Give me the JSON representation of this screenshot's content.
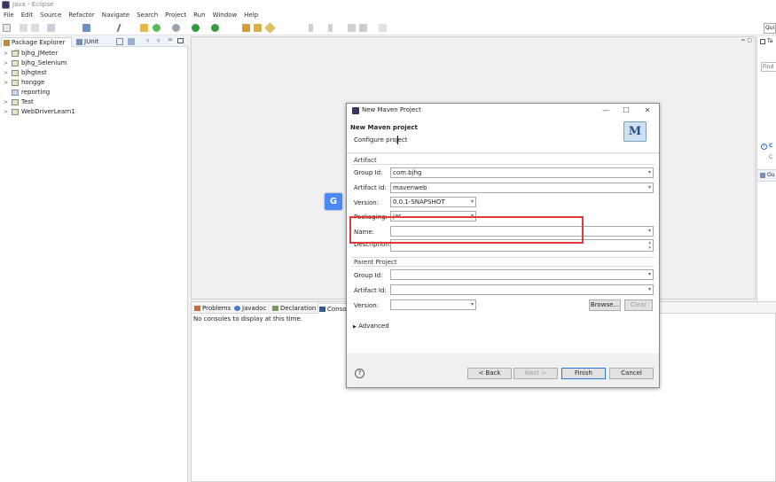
{
  "window": {
    "title": "Java - Eclipse"
  },
  "menu": [
    "File",
    "Edit",
    "Source",
    "Refactor",
    "Navigate",
    "Search",
    "Project",
    "Run",
    "Window",
    "Help"
  ],
  "quick_access": {
    "label": "Qui"
  },
  "package_explorer": {
    "tab_label": "Package Explorer",
    "tab_close": "☒",
    "junit_tab": "JUnit",
    "items": [
      {
        "label": "bjhg_JMeter",
        "type": "project"
      },
      {
        "label": "bjhg_Selenium",
        "type": "project"
      },
      {
        "label": "bjhgtest",
        "type": "project"
      },
      {
        "label": "hongge",
        "type": "project"
      },
      {
        "label": "reporting",
        "type": "folder"
      },
      {
        "label": "Test",
        "type": "project"
      },
      {
        "label": "WebDriverLearn1",
        "type": "project"
      }
    ]
  },
  "right_panel": {
    "tab_label": "Ta",
    "find_placeholder": "Find",
    "item1": "C",
    "item2": "C",
    "outline_label": "Ou"
  },
  "console": {
    "tabs": [
      "Problems",
      "Javadoc",
      "Declaration",
      "Consol"
    ],
    "message": "No consoles to display at this time."
  },
  "dialog": {
    "title": "New Maven Project",
    "header_title": "New Maven project",
    "header_subtitle": "Configure project",
    "logo_letter": "M",
    "artifact_group": "Artifact",
    "group_id_label": "Group Id:",
    "group_id_value": "com.bjhg",
    "artifact_id_label": "Artifact Id:",
    "artifact_id_value": "mavenweb",
    "version_label": "Version:",
    "version_value": "0.0.1-SNAPSHOT",
    "packaging_label": "Packaging:",
    "packaging_value": "jar",
    "name_label": "Name:",
    "name_value": "",
    "description_label": "Description:",
    "description_value": "",
    "parent_group": "Parent Project",
    "parent_group_id_label": "Group Id:",
    "parent_artifact_id_label": "Artifact Id:",
    "parent_version_label": "Version:",
    "browse_button": "Browse...",
    "clear_button": "Clear",
    "advanced_label": "Advanced",
    "back_button": "< Back",
    "next_button": "Next >",
    "finish_button": "Finish",
    "cancel_button": "Cancel",
    "help_symbol": "?"
  }
}
